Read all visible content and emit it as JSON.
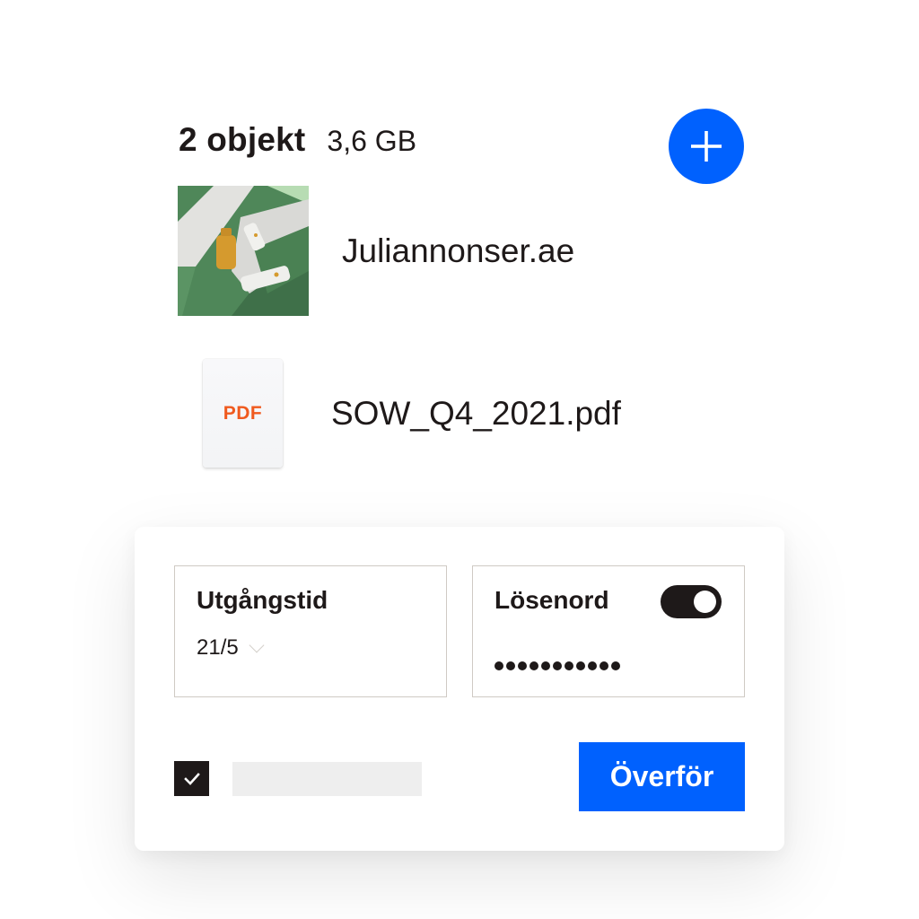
{
  "header": {
    "item_count": "2 objekt",
    "total_size": "3,6 GB",
    "add_button_icon": "plus-icon"
  },
  "files": [
    {
      "name": "Juliannonser.ae",
      "thumbnail": "product-image-thumbnail"
    },
    {
      "name": "SOW_Q4_2021.pdf",
      "icon_label": "PDF"
    }
  ],
  "settings": {
    "expiry": {
      "label": "Utgångstid",
      "value": "21/5"
    },
    "password": {
      "label": "Lösenord",
      "toggle_on": true,
      "masked_length": 11
    },
    "checkbox_checked": true,
    "transfer_button": "Överför"
  },
  "colors": {
    "accent": "#0061fe",
    "text": "#1e1919",
    "pdf_label": "#f05a1e"
  }
}
